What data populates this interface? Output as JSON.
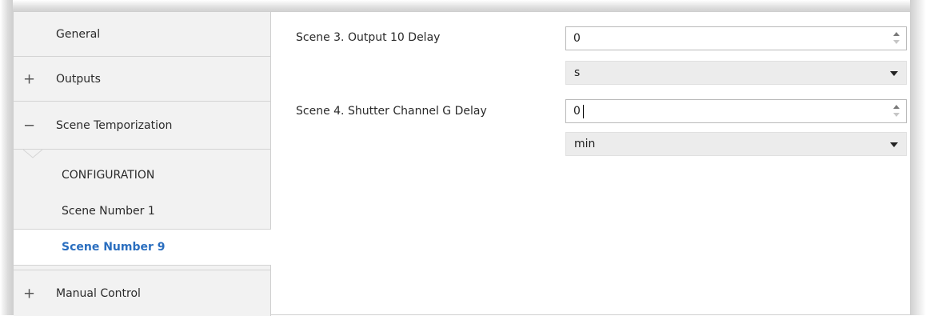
{
  "sidebar": {
    "items": [
      {
        "sign": "",
        "label": "General"
      },
      {
        "sign": "+",
        "label": "Outputs"
      },
      {
        "sign": "−",
        "label": "Scene Temporization"
      },
      {
        "sign": "+",
        "label": "Manual Control"
      }
    ],
    "sub_items": [
      {
        "label": "CONFIGURATION"
      },
      {
        "label": "Scene Number 1"
      },
      {
        "label": "Scene Number 9"
      }
    ]
  },
  "main": {
    "fields": [
      {
        "label": "Scene 3. Output 10 Delay",
        "value": "0",
        "unit": "s"
      },
      {
        "label": "Scene 4. Shutter Channel G Delay",
        "value": "0",
        "unit": "min"
      }
    ]
  }
}
